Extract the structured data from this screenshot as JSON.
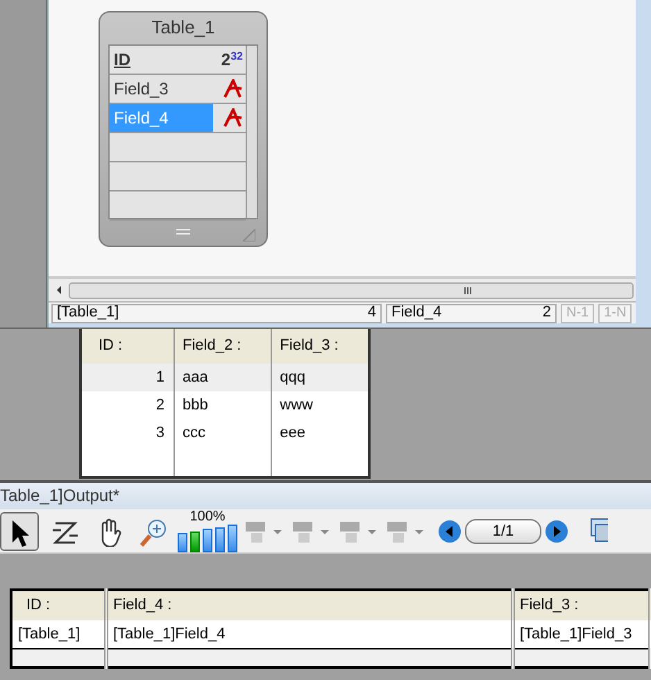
{
  "structure": {
    "table": {
      "title": "Table_1",
      "fields": [
        {
          "name": "ID",
          "kind": "long",
          "type_label": "2$^{32}$",
          "selected": false
        },
        {
          "name": "Field_3",
          "kind": "alpha",
          "selected": false
        },
        {
          "name": "Field_4",
          "kind": "alpha",
          "selected": true
        }
      ]
    },
    "status_bar": {
      "table": "[Table_1]",
      "field_count": "4",
      "field": "Field_4",
      "field_number": "2",
      "buttons": [
        {
          "label": "N-1",
          "disabled": true
        },
        {
          "label": "1-N",
          "disabled": true
        }
      ]
    }
  },
  "list": {
    "columns": [
      "ID :",
      "Field_2 :",
      "Field_3 :"
    ],
    "rows": [
      {
        "cells": [
          "1",
          "aaa",
          "qqq"
        ],
        "selected": true
      },
      {
        "cells": [
          "2",
          "bbb",
          "www"
        ],
        "selected": false
      },
      {
        "cells": [
          "3",
          "ccc",
          "eee"
        ],
        "selected": false
      }
    ]
  },
  "output_window": {
    "title": "Table_1]Output*",
    "tools": [
      {
        "kind": "arrow",
        "selected": true
      },
      {
        "kind": "z-order",
        "selected": false
      },
      {
        "kind": "hand",
        "selected": false
      },
      {
        "kind": "zoom",
        "selected": false
      }
    ],
    "zoom_label": "100%",
    "zoom_bars": [
      {
        "selected": false
      },
      {
        "selected": true
      },
      {
        "selected": false
      },
      {
        "selected": false
      },
      {
        "selected": false
      }
    ],
    "page": "1/1"
  },
  "form": {
    "columns": [
      "ID :",
      "Field_4 :",
      "Field_3 :"
    ],
    "cells": [
      "[Table_1]",
      "[Table_1]Field_4",
      "[Table_1]Field_3"
    ]
  }
}
